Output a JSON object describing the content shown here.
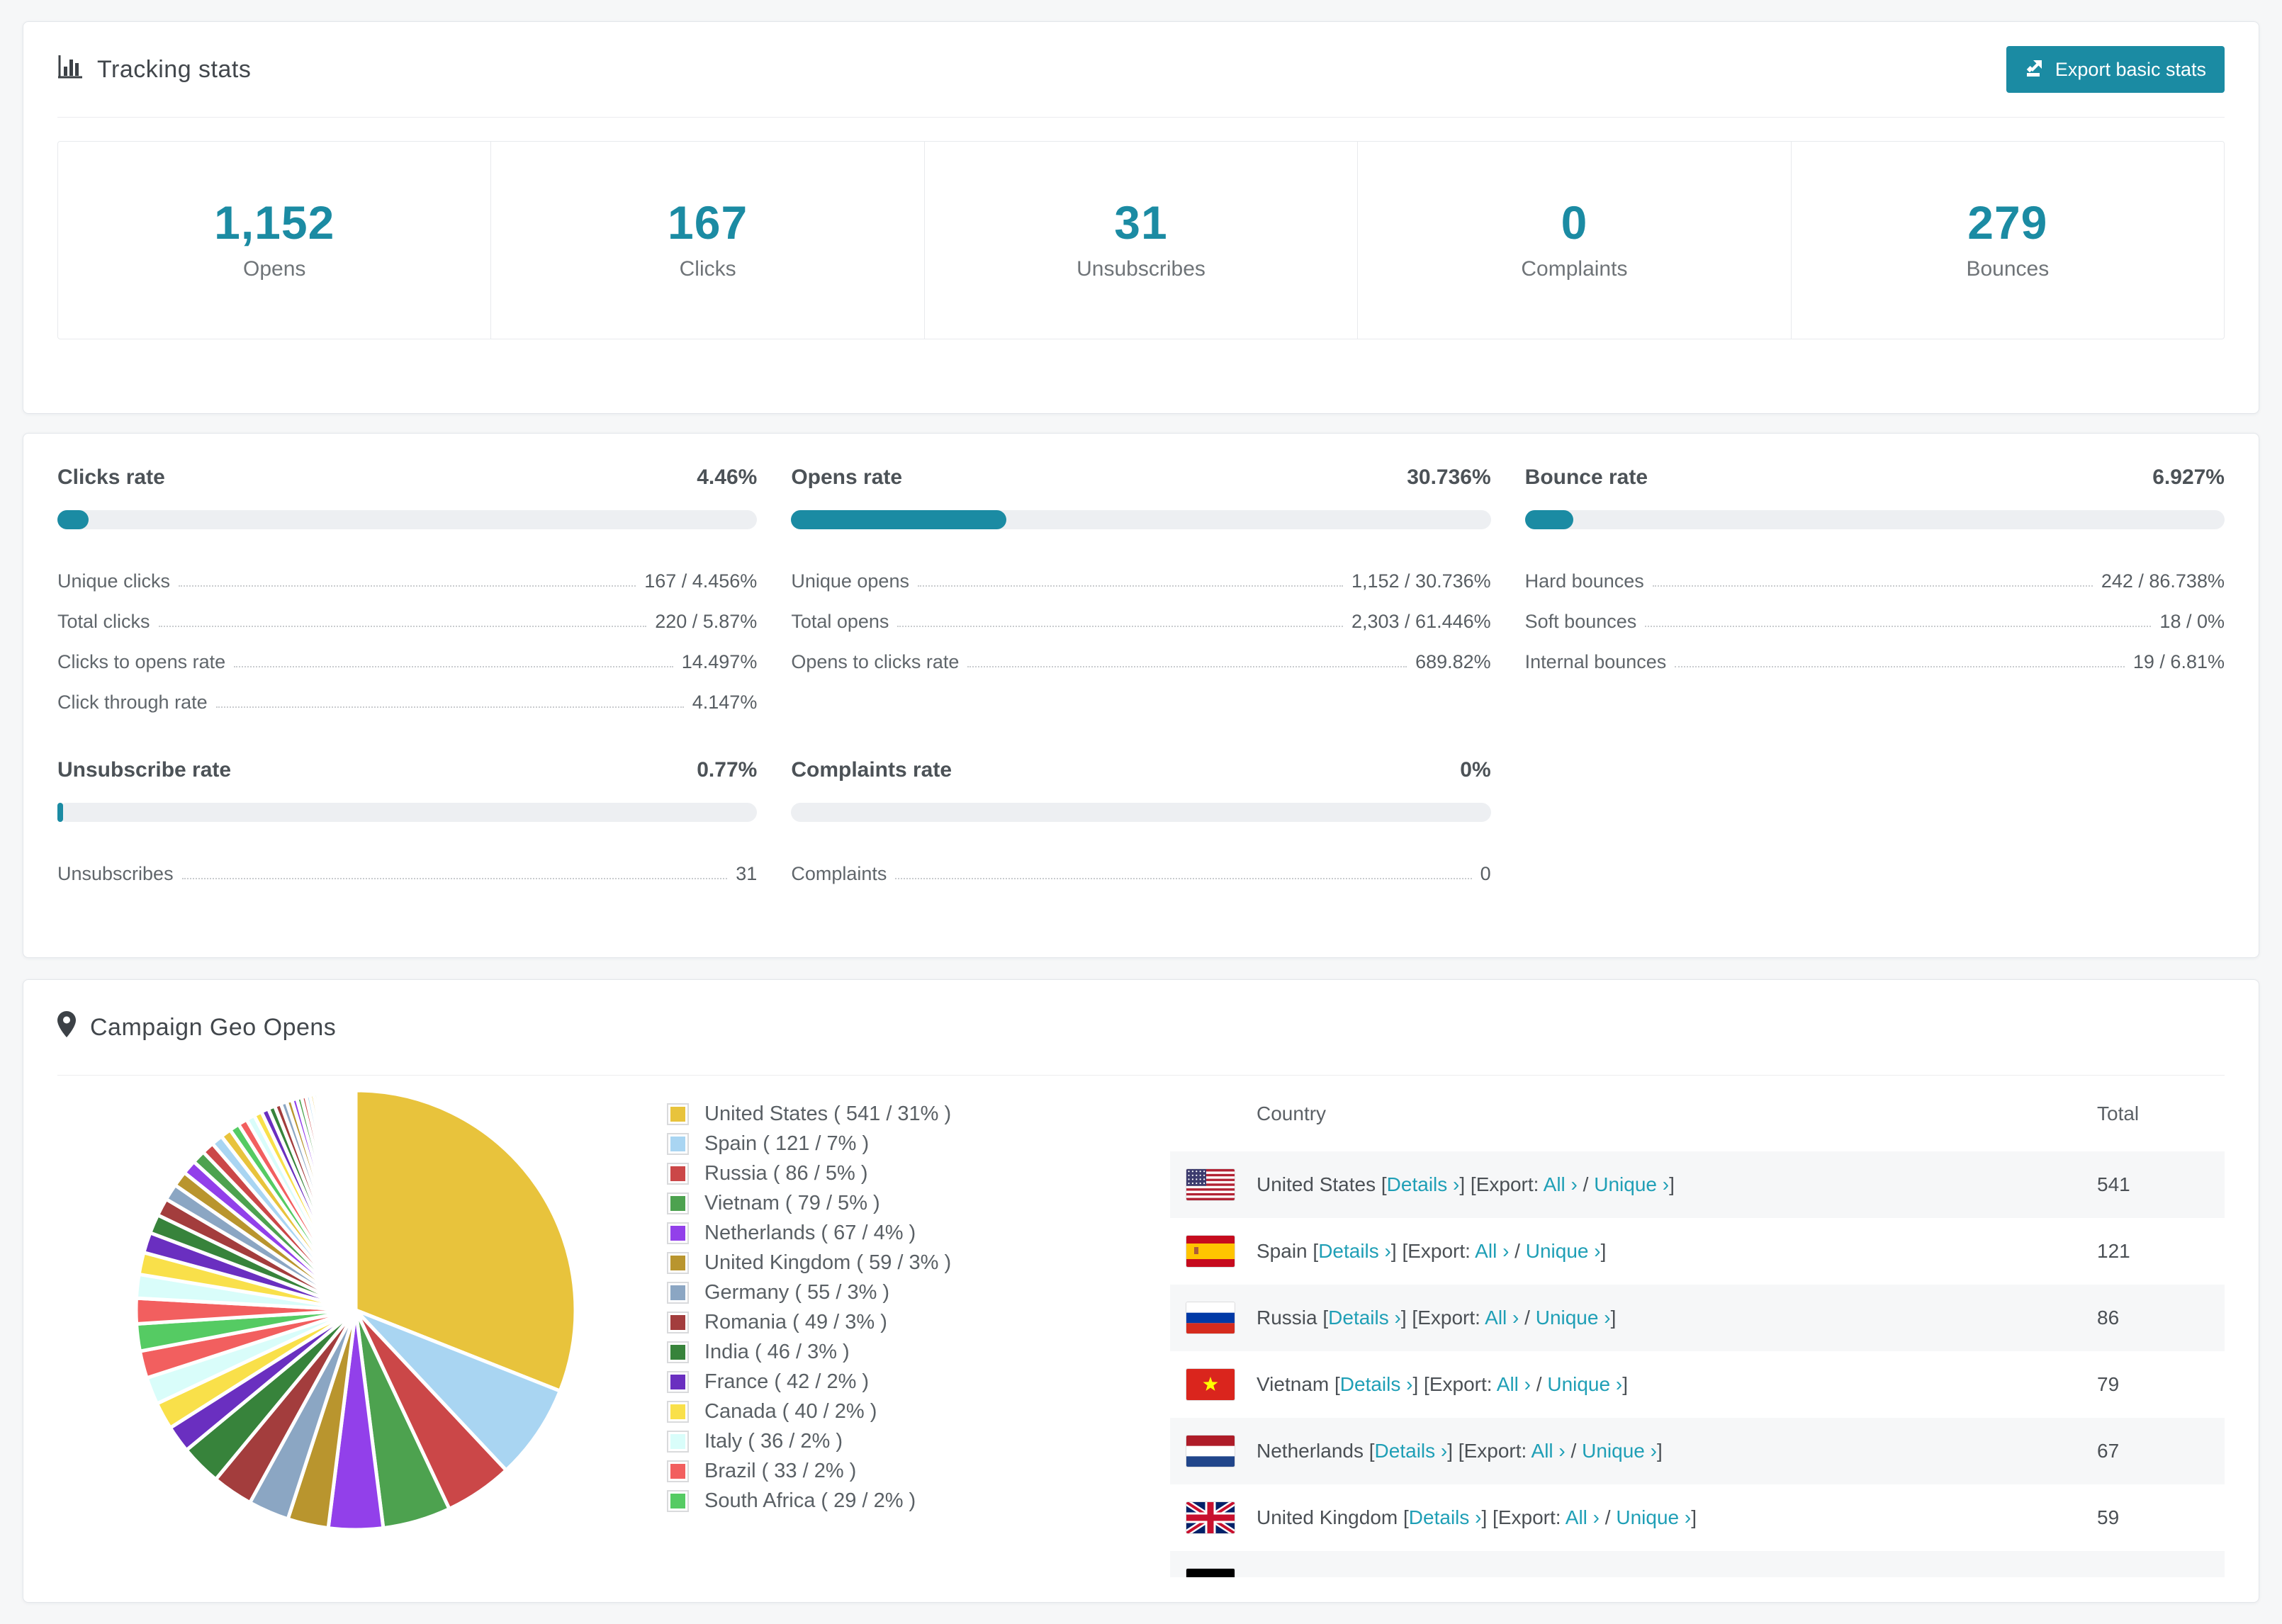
{
  "colors": {
    "accent": "#1b8ba3",
    "link": "#1f9fb6",
    "bar_track": "#edeff2",
    "row_stripe": "#f6f7f8"
  },
  "tracking": {
    "title": "Tracking stats",
    "export_button": "Export basic stats"
  },
  "summary": [
    {
      "value": "1,152",
      "label": "Opens"
    },
    {
      "value": "167",
      "label": "Clicks"
    },
    {
      "value": "31",
      "label": "Unsubscribes"
    },
    {
      "value": "0",
      "label": "Complaints"
    },
    {
      "value": "279",
      "label": "Bounces"
    }
  ],
  "rates": [
    {
      "title": "Clicks rate",
      "value": "4.46%",
      "percent": 4.46,
      "rows": [
        {
          "label": "Unique clicks",
          "value": "167 / 4.456%"
        },
        {
          "label": "Total clicks",
          "value": "220 / 5.87%"
        },
        {
          "label": "Clicks to opens rate",
          "value": "14.497%"
        },
        {
          "label": "Click through rate",
          "value": "4.147%"
        }
      ]
    },
    {
      "title": "Opens rate",
      "value": "30.736%",
      "percent": 30.736,
      "rows": [
        {
          "label": "Unique opens",
          "value": "1,152 / 30.736%"
        },
        {
          "label": "Total opens",
          "value": "2,303 / 61.446%"
        },
        {
          "label": "Opens to clicks rate",
          "value": "689.82%"
        }
      ]
    },
    {
      "title": "Bounce rate",
      "value": "6.927%",
      "percent": 6.927,
      "rows": [
        {
          "label": "Hard bounces",
          "value": "242 / 86.738%"
        },
        {
          "label": "Soft bounces",
          "value": "18 / 0%"
        },
        {
          "label": "Internal bounces",
          "value": "19 / 6.81%"
        }
      ]
    },
    {
      "title": "Unsubscribe rate",
      "value": "0.77%",
      "percent": 0.77,
      "rows": [
        {
          "label": "Unsubscribes",
          "value": "31"
        }
      ]
    },
    {
      "title": "Complaints rate",
      "value": "0%",
      "percent": 0,
      "rows": [
        {
          "label": "Complaints",
          "value": "0"
        }
      ]
    }
  ],
  "geo": {
    "title": "Campaign Geo Opens",
    "table_headers": {
      "country": "Country",
      "total": "Total"
    },
    "link_labels": {
      "details": "Details ›",
      "export_prefix": "Export:",
      "all": "All ›",
      "unique": "Unique ›",
      "bracket_open": "[",
      "bracket_close": "]",
      "slash": "/"
    },
    "table_rows": [
      {
        "flag": "us",
        "country": "United States",
        "total": "541"
      },
      {
        "flag": "es",
        "country": "Spain",
        "total": "121"
      },
      {
        "flag": "ru",
        "country": "Russia",
        "total": "86"
      },
      {
        "flag": "vn",
        "country": "Vietnam",
        "total": "79"
      },
      {
        "flag": "nl",
        "country": "Netherlands",
        "total": "67"
      },
      {
        "flag": "gb",
        "country": "United Kingdom",
        "total": "59"
      },
      {
        "flag": "de",
        "country": "",
        "total": ""
      }
    ]
  },
  "chart_data": {
    "type": "pie",
    "title": "Campaign Geo Opens",
    "legend_position": "right",
    "start_angle": 0,
    "direction": "clockwise",
    "series": [
      {
        "name": "United States",
        "value": 541,
        "percent": 31,
        "color": "#e8c33c"
      },
      {
        "name": "Spain",
        "value": 121,
        "percent": 7,
        "color": "#a9d5f2"
      },
      {
        "name": "Russia",
        "value": 86,
        "percent": 5,
        "color": "#cb4748"
      },
      {
        "name": "Vietnam",
        "value": 79,
        "percent": 5,
        "color": "#4da24f"
      },
      {
        "name": "Netherlands",
        "value": 67,
        "percent": 4,
        "color": "#9240ea"
      },
      {
        "name": "United Kingdom",
        "value": 59,
        "percent": 3,
        "color": "#b9952e"
      },
      {
        "name": "Germany",
        "value": 55,
        "percent": 3,
        "color": "#8ba6c3"
      },
      {
        "name": "Romania",
        "value": 49,
        "percent": 3,
        "color": "#a33d3d"
      },
      {
        "name": "India",
        "value": 46,
        "percent": 3,
        "color": "#37833b"
      },
      {
        "name": "France",
        "value": 42,
        "percent": 2,
        "color": "#6a2fc0"
      },
      {
        "name": "Canada",
        "value": 40,
        "percent": 2,
        "color": "#f9e04a"
      },
      {
        "name": "Italy",
        "value": 36,
        "percent": 2,
        "color": "#d9fdfa"
      },
      {
        "name": "Brazil",
        "value": 33,
        "percent": 2,
        "color": "#f25f5f"
      },
      {
        "name": "South Africa",
        "value": 29,
        "percent": 2,
        "color": "#55cb63"
      }
    ],
    "unlabeled_remainder_percent": 26
  }
}
